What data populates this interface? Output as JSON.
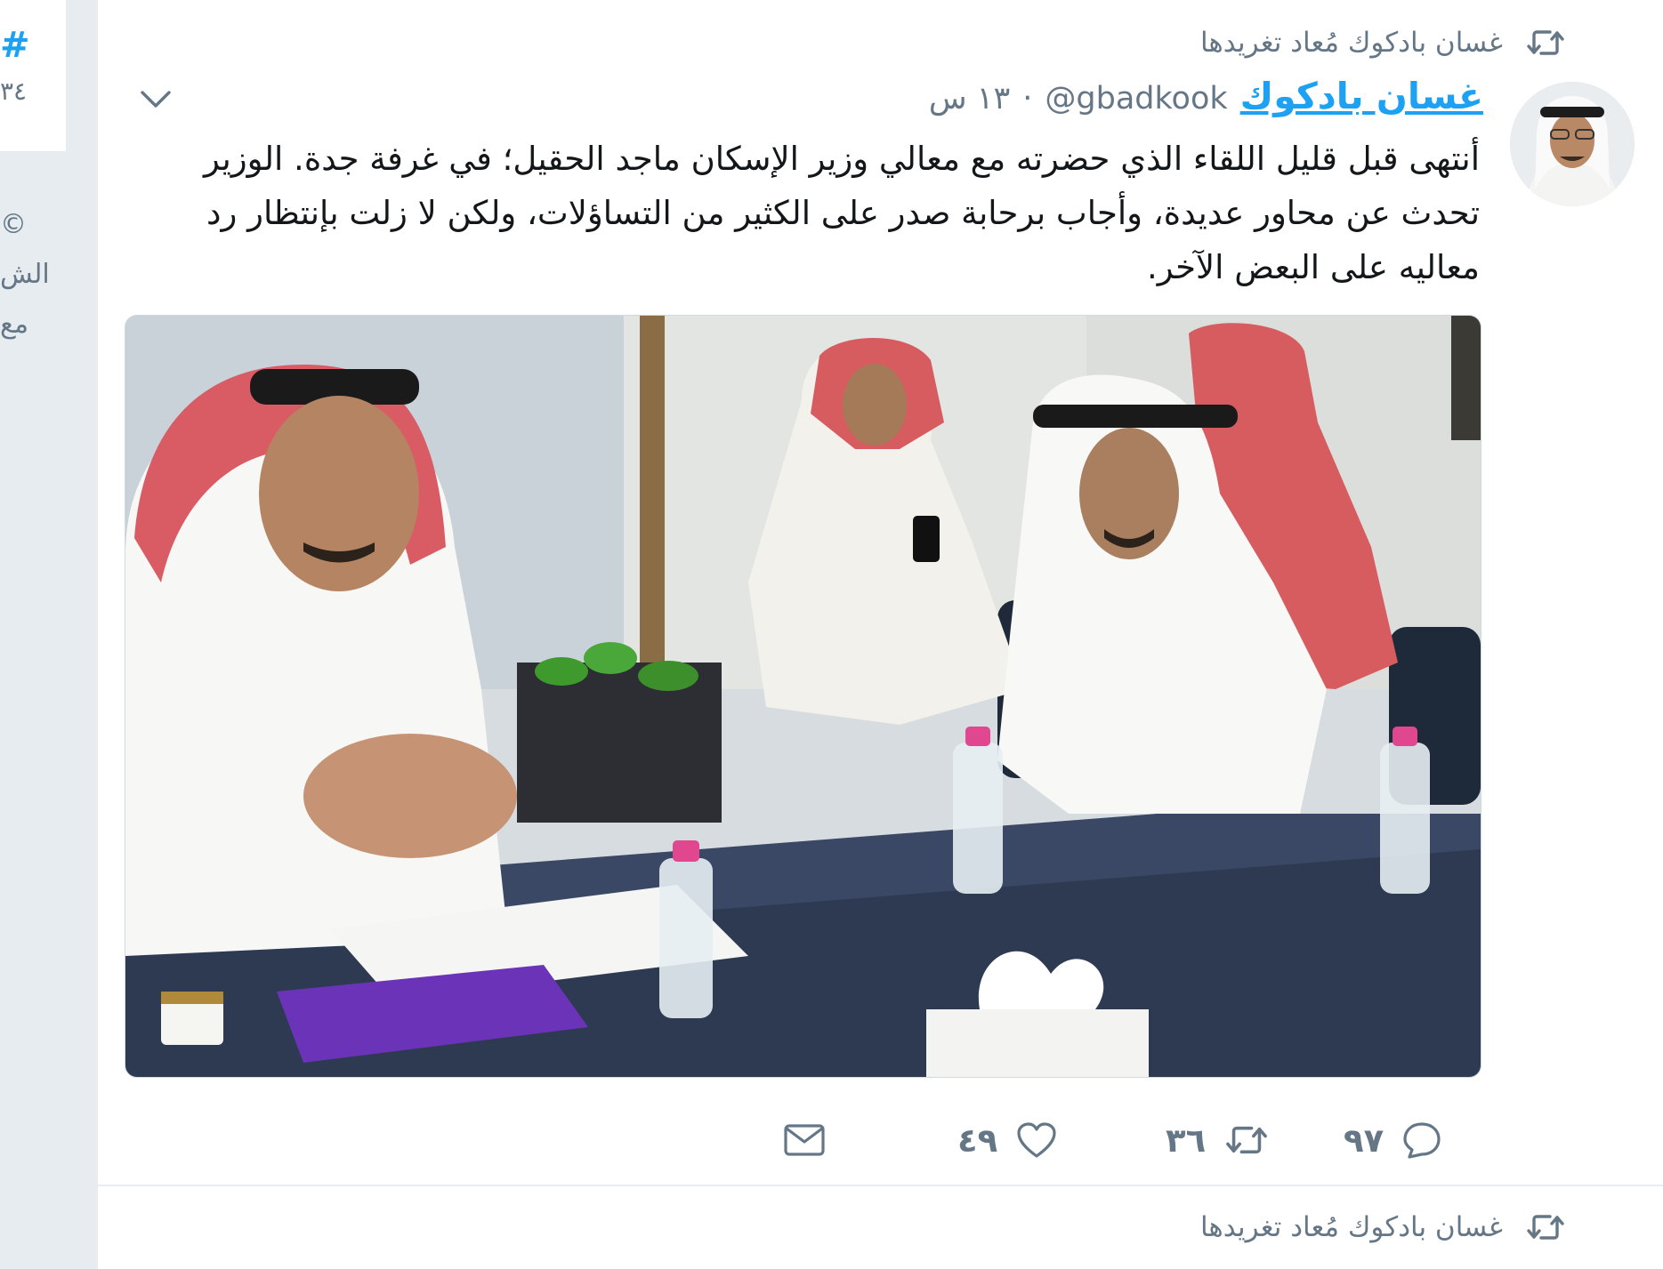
{
  "left_sidebar": {
    "hashtag_symbol": "#",
    "count_fragment": "٣٤",
    "footer_lines": [
      "©",
      "الش",
      "مع"
    ]
  },
  "tweet": {
    "retweet_context": "غسان بادكوك مُعاد تغريدها",
    "author_name": "غسان بادكوك",
    "author_handle": "@gbadkook",
    "separator": "·",
    "timestamp": "١٣ س",
    "text": "أنتهى قبل قليل اللقاء الذي حضرته مع معالي وزير الإسكان ماجد الحقيل؛ في غرفة جدة. الوزير تحدث عن محاور عديدة، وأجاب برحابة صدر على الكثير من التساؤلات، ولكن لا زلت بإنتظار رد معاليه على البعض الآخر.",
    "media_alt": "photo",
    "actions": {
      "reply_count": "٩٧",
      "retweet_count": "٣٦",
      "like_count": "٤٩"
    }
  },
  "next_tweet": {
    "retweet_context": "غسان بادكوك مُعاد تغريدها"
  },
  "colors": {
    "accent": "#1da1f2",
    "secondary_text": "#657786",
    "background": "#e6ecf0"
  },
  "icons": {
    "retweet": "retweet-icon",
    "reply": "reply-icon",
    "like": "heart-icon",
    "dm": "envelope-icon",
    "caret": "chevron-down-icon"
  }
}
